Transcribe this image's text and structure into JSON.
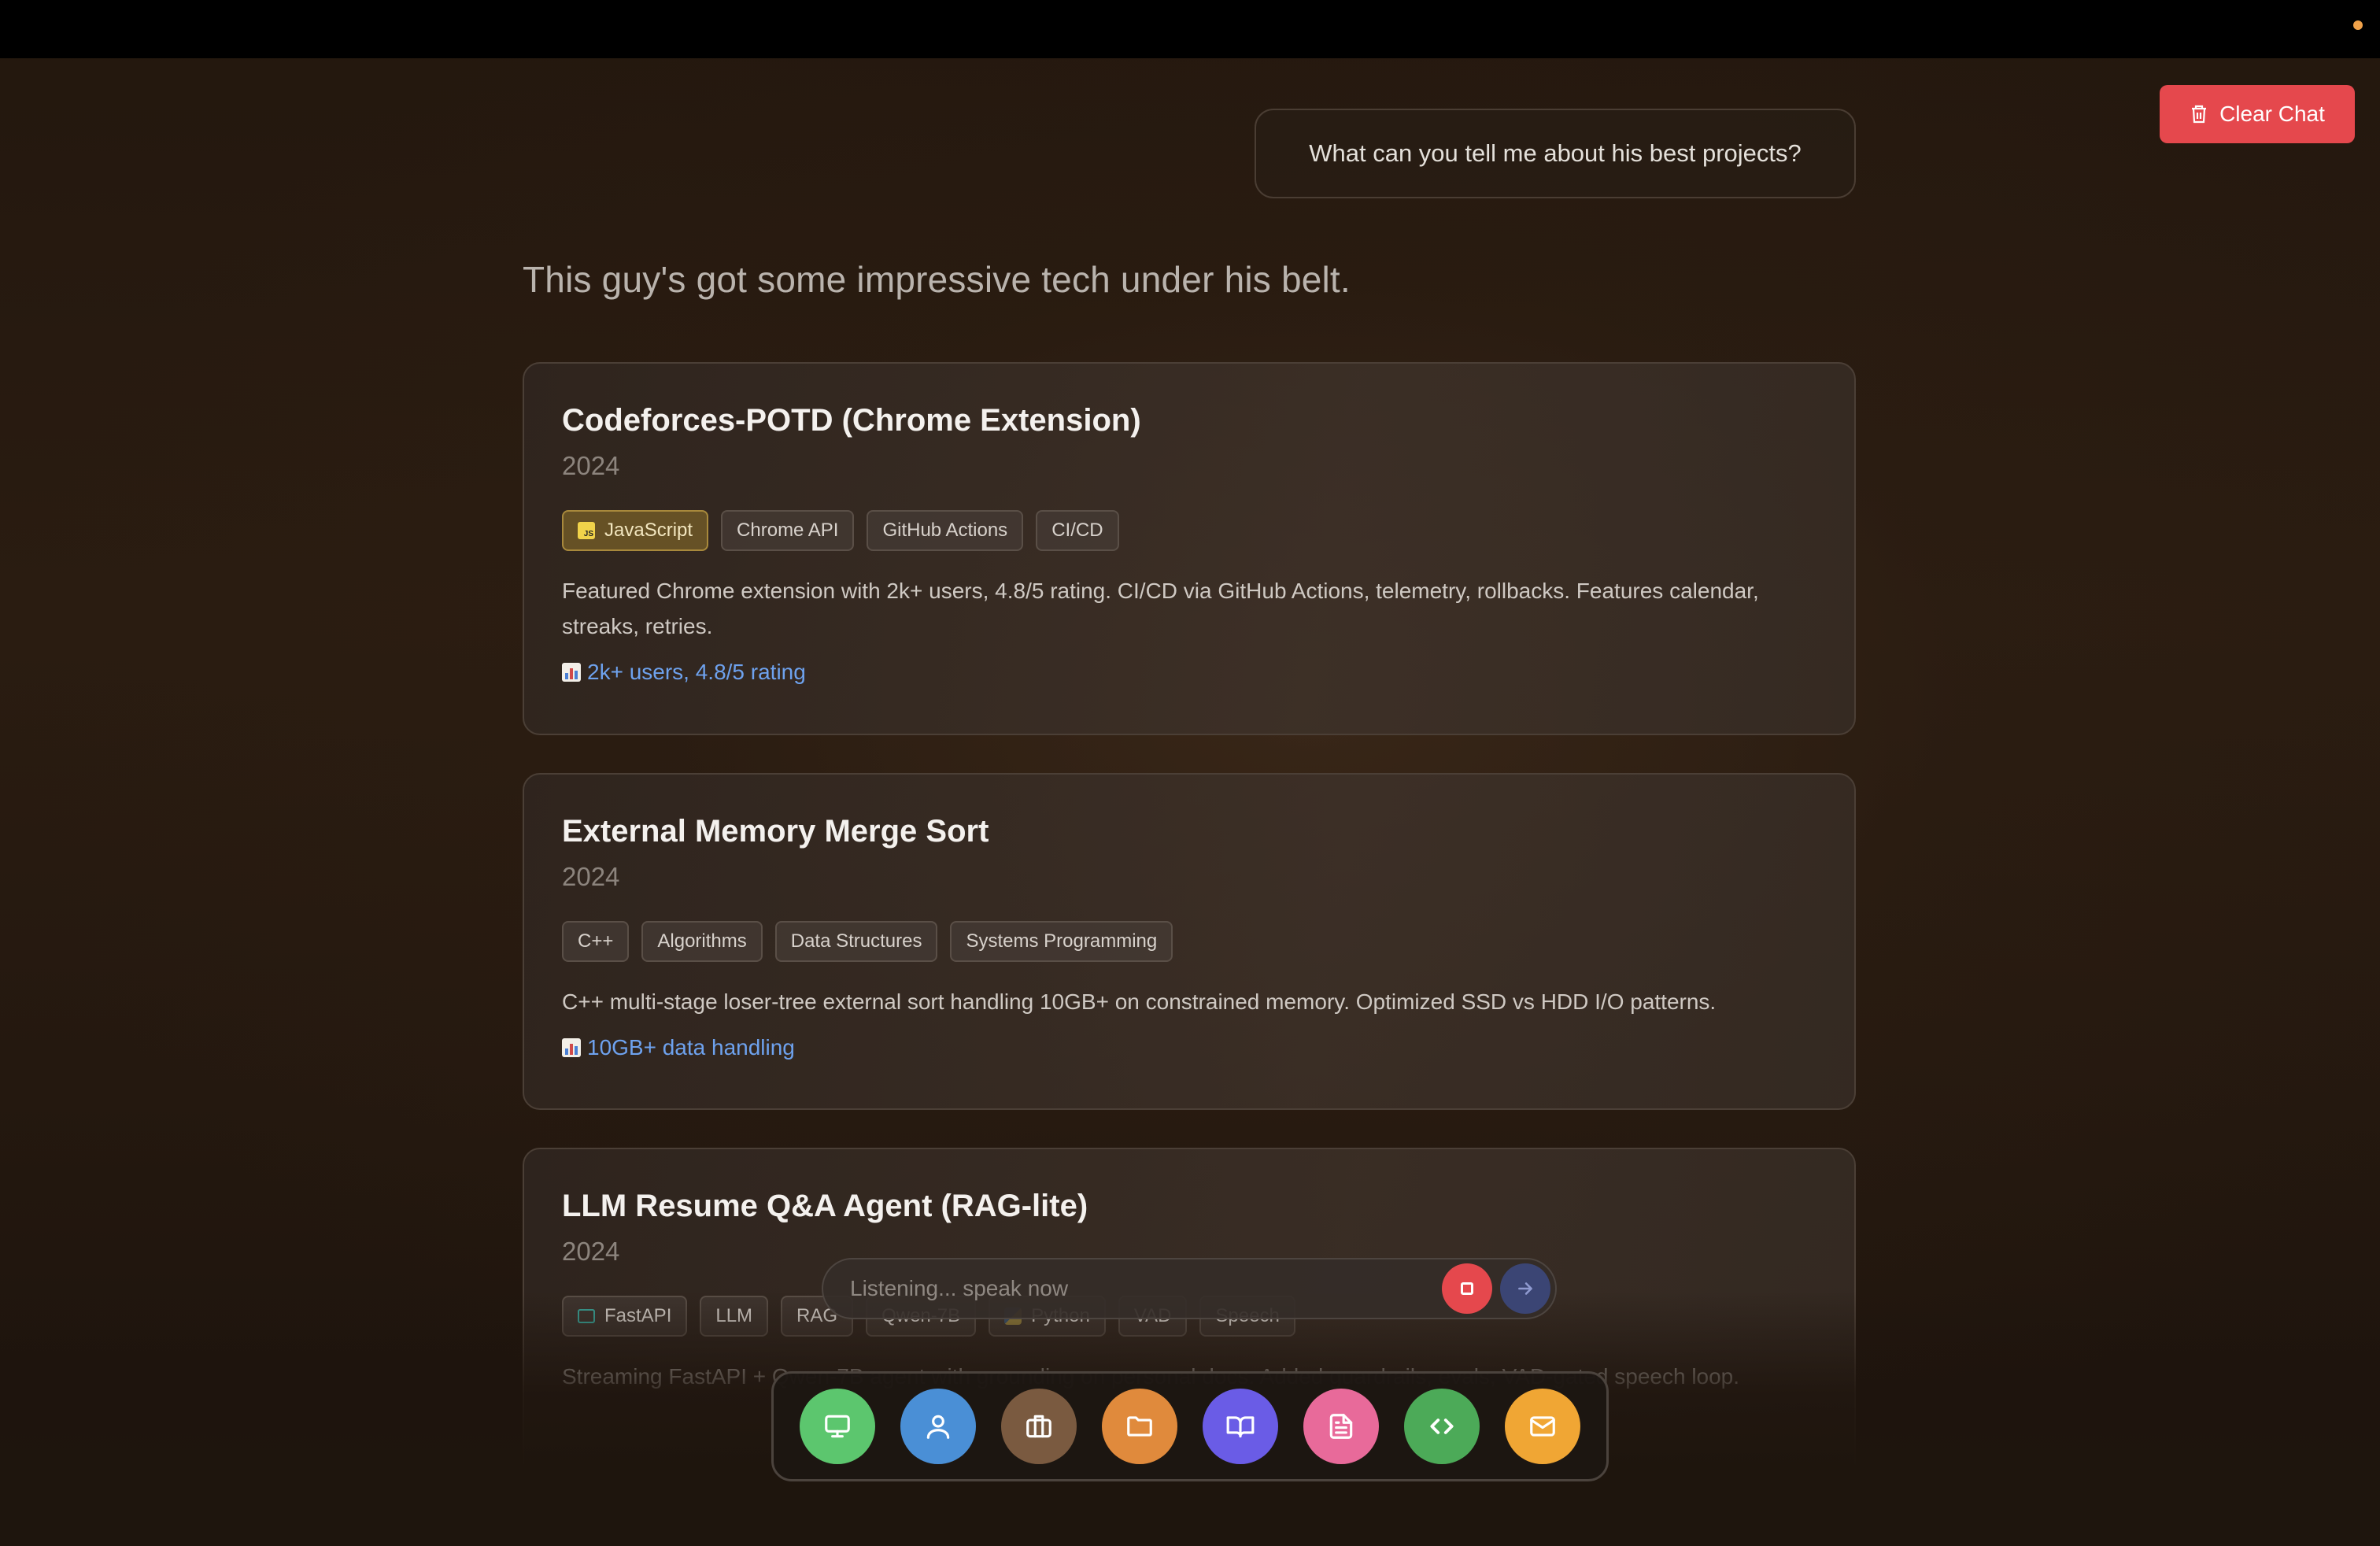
{
  "header": {
    "clear_chat_label": "Clear Chat"
  },
  "chat": {
    "user_message": "What can you tell me about his best projects?",
    "intro": "This guy's got some impressive tech under his belt."
  },
  "projects": [
    {
      "title": "Codeforces-POTD (Chrome Extension)",
      "year": "2024",
      "tags": [
        "JavaScript",
        "Chrome API",
        "GitHub Actions",
        "CI/CD"
      ],
      "description": "Featured Chrome extension with 2k+ users, 4.8/5 rating. CI/CD via GitHub Actions, telemetry, rollbacks. Features calendar, streaks, retries.",
      "metric": "2k+ users, 4.8/5 rating"
    },
    {
      "title": "External Memory Merge Sort",
      "year": "2024",
      "tags": [
        "C++",
        "Algorithms",
        "Data Structures",
        "Systems Programming"
      ],
      "description": "C++ multi-stage loser-tree external sort handling 10GB+ on constrained memory. Optimized SSD vs HDD I/O patterns.",
      "metric": "10GB+ data handling"
    },
    {
      "title": "LLM Resume Q&A Agent (RAG-lite)",
      "year": "2024",
      "tags": [
        "FastAPI",
        "LLM",
        "RAG",
        "Qwen-7B",
        "Python",
        "VAD",
        "Speech"
      ],
      "description": "Streaming FastAPI + Qwen-7B agent with grounding on personal docs. Added guardrails, evals, VAD-gated speech loop."
    }
  ],
  "voice": {
    "placeholder": "Listening... speak now"
  },
  "dock": {
    "items": [
      {
        "icon": "monitor-icon",
        "color": "#5cc66e"
      },
      {
        "icon": "user-icon",
        "color": "#4a8fd6"
      },
      {
        "icon": "briefcase-icon",
        "color": "#7a5a40"
      },
      {
        "icon": "folder-icon",
        "color": "#e08a3c"
      },
      {
        "icon": "book-icon",
        "color": "#6a5ce6"
      },
      {
        "icon": "document-icon",
        "color": "#e86a9a"
      },
      {
        "icon": "code-icon",
        "color": "#4caa58"
      },
      {
        "icon": "mail-icon",
        "color": "#f0a634"
      }
    ]
  },
  "colors": {
    "accent_red": "#e5484d",
    "metric_blue": "#6ea2ee",
    "background": "#24180f"
  }
}
